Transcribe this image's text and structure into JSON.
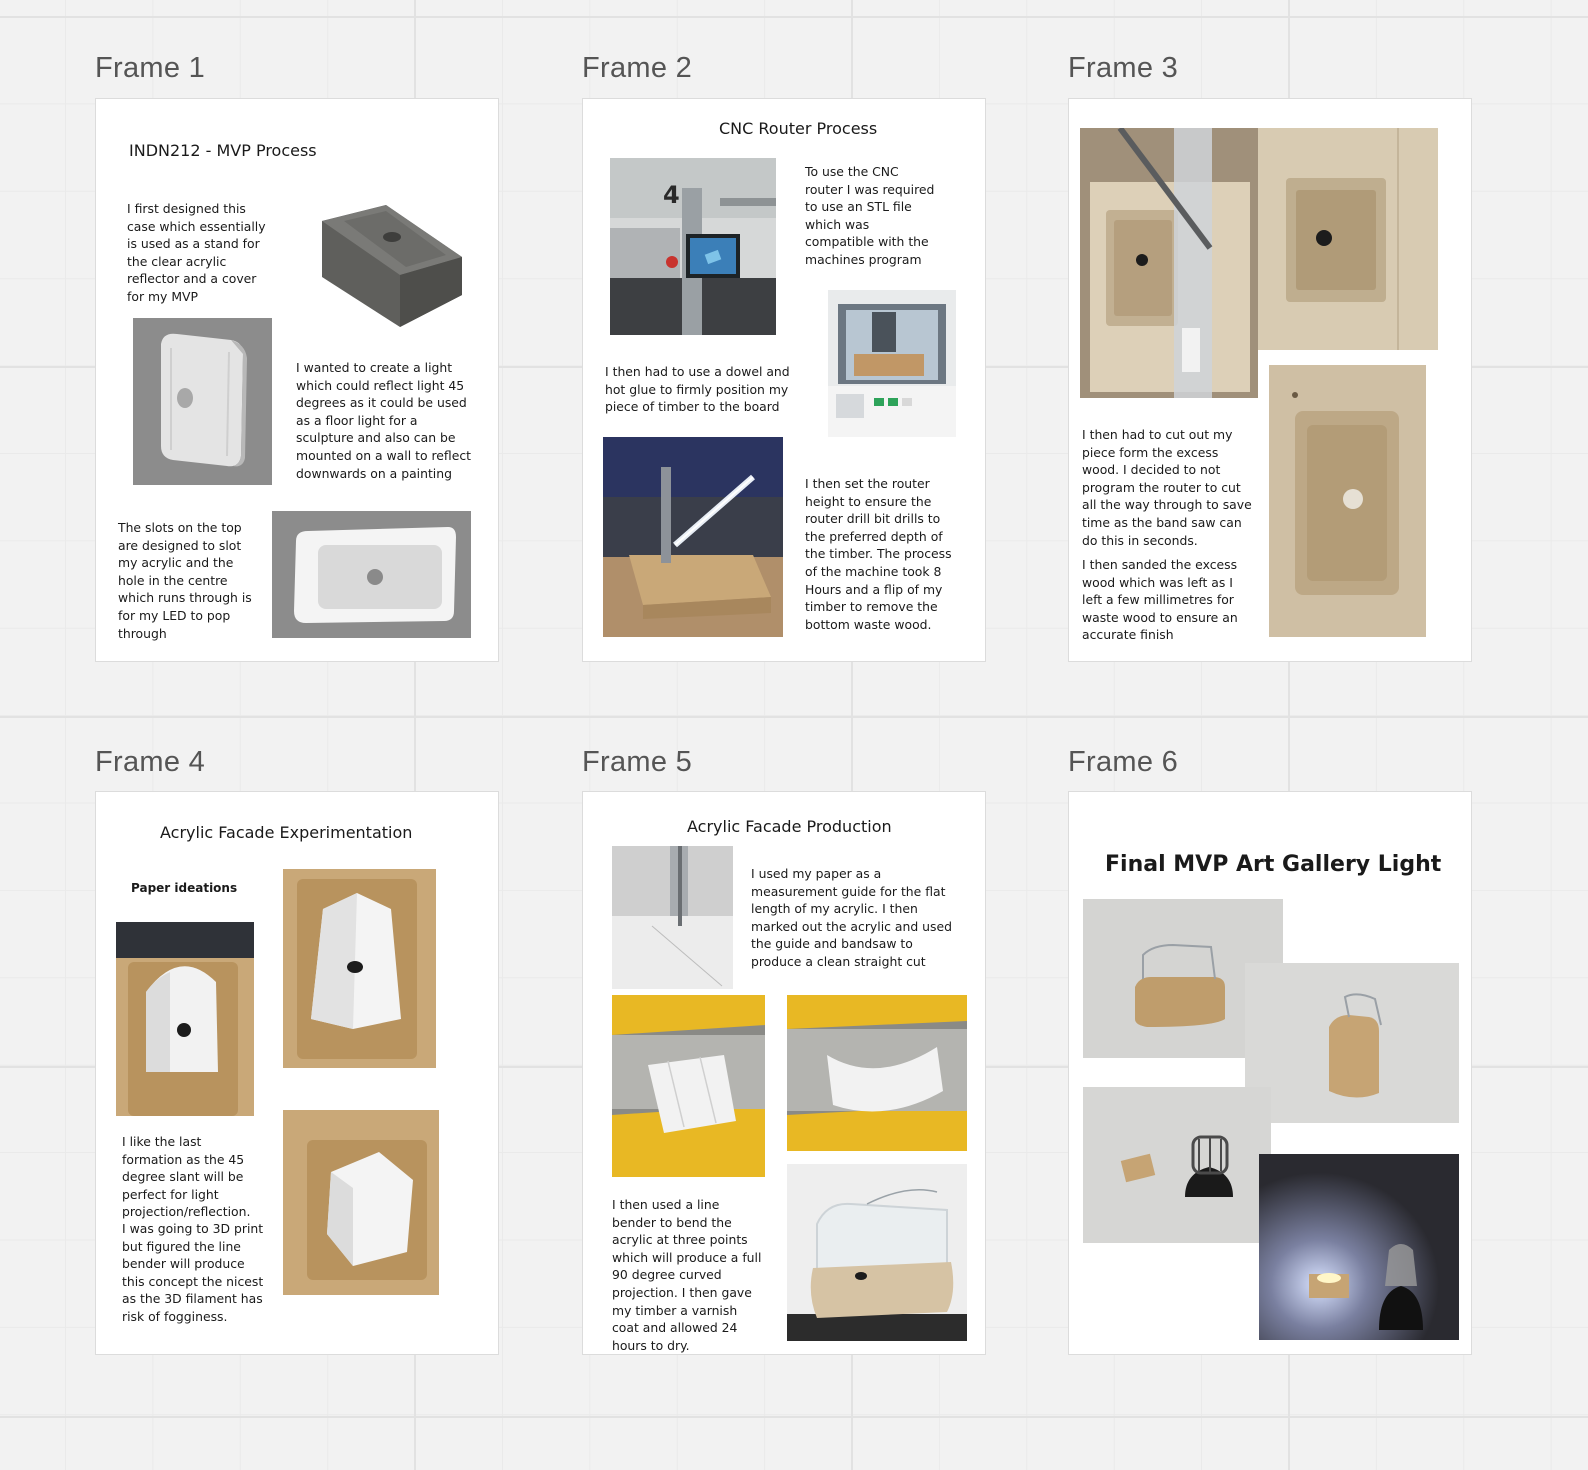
{
  "frames": [
    {
      "label": "Frame 1",
      "title": "INDN212 - MVP Process",
      "texts": [
        "I first designed this case which essentially is used as a stand for the clear acrylic reflector and a cover for my MVP",
        "I wanted to create a light which could reflect light 45 degrees as it could be used as a floor light for a sculpture and also can be mounted on a wall to reflect downwards on a painting",
        "The slots on the top are designed to slot my acrylic and the hole in the centre which runs through is for my LED to pop through"
      ]
    },
    {
      "label": "Frame 2",
      "title": "CNC Router Process",
      "texts": [
        "To use the CNC router I was required to use an STL file which was compatible with the machines program",
        "I then had to use a dowel and hot glue to firmly position my piece of timber to the board",
        "I then set the router height to ensure the router drill bit drills to the preferred depth of the timber. The process of the machine took 8 Hours and a flip of my timber to remove the bottom waste wood."
      ]
    },
    {
      "label": "Frame 3",
      "title": "",
      "texts": [
        "I then had to cut out my piece form the excess wood. I decided to not program the router to cut all the way through to save time as the band saw can do this in seconds.",
        "I then sanded the excess wood which was left as I left a few millimetres for waste wood to ensure an accurate finish"
      ]
    },
    {
      "label": "Frame 4",
      "title": "Acrylic Facade Experimentation",
      "subtitle": "Paper ideations",
      "texts": [
        "I like the last formation as the 45 degree slant will be perfect for light projection/reflection.",
        "I was going to 3D print but figured the line bender will produce this concept the nicest as the 3D filament has risk of fogginess."
      ]
    },
    {
      "label": "Frame 5",
      "title": "Acrylic Facade Production",
      "texts": [
        "I used my paper as a measurement guide for the flat length of my acrylic. I then marked out the acrylic and used the guide and bandsaw to produce a clean straight cut",
        "I then used a line bender to bend the acrylic at three points which will produce a full 90 degree curved projection. I then gave my timber a varnish coat and allowed 24 hours to dry."
      ]
    },
    {
      "label": "Frame 6",
      "title": "Final MVP Art Gallery Light",
      "texts": []
    }
  ],
  "photo_numbers": {
    "machine_number": "4"
  },
  "colors": {
    "canvas_bg": "#f2f2f2",
    "frame_bg": "#ffffff",
    "frame_border": "#dcdcdc",
    "label_text": "#555555",
    "wood": "#c9a878",
    "gray_render": "#8c8c8c",
    "yellow_machine": "#e8b824"
  }
}
